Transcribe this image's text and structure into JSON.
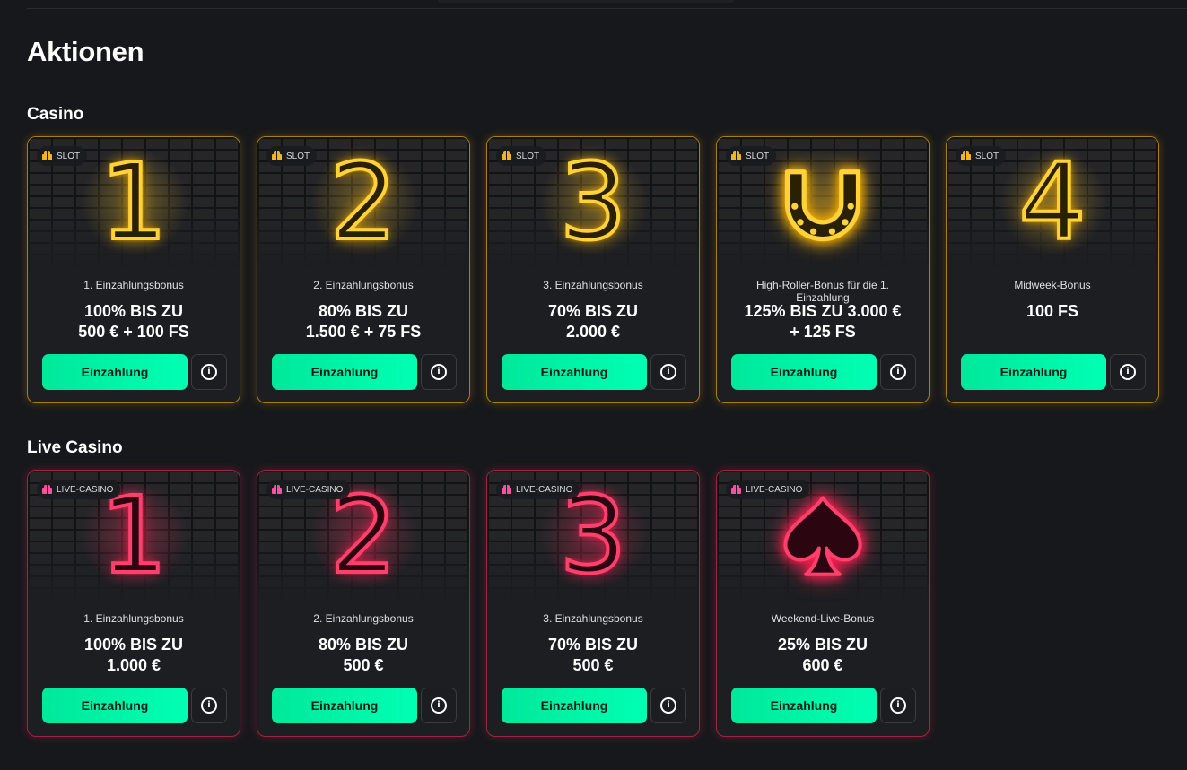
{
  "page_title": "Aktionen",
  "sections": [
    {
      "title": "Casino",
      "cards": [
        {
          "badge": "SLOT",
          "icon": "neon-number-1-icon",
          "glyph": "1",
          "name": "1. Einzahlungsbonus",
          "offer": "100% BIS ZU\n500 € + 100 FS",
          "button": "Einzahlung"
        },
        {
          "badge": "SLOT",
          "icon": "neon-number-2-icon",
          "glyph": "2",
          "name": "2. Einzahlungsbonus",
          "offer": "80% BIS ZU\n1.500 € + 75 FS",
          "button": "Einzahlung"
        },
        {
          "badge": "SLOT",
          "icon": "neon-number-3-icon",
          "glyph": "3",
          "name": "3. Einzahlungsbonus",
          "offer": "70% BIS ZU\n2.000 €",
          "button": "Einzahlung"
        },
        {
          "badge": "SLOT",
          "icon": "neon-horseshoe-icon",
          "glyph": "",
          "name": "High-Roller-Bonus für die 1. Einzahlung",
          "offer": "125% BIS ZU 3.000 €\n+ 125 FS",
          "button": "Einzahlung"
        },
        {
          "badge": "SLOT",
          "icon": "neon-number-4-icon",
          "glyph": "4",
          "name": "Midweek-Bonus",
          "offer": "100 FS",
          "button": "Einzahlung"
        }
      ]
    },
    {
      "title": "Live Casino",
      "cards": [
        {
          "badge": "LIVE-CASINO",
          "icon": "neon-number-1-icon",
          "glyph": "1",
          "name": "1. Einzahlungsbonus",
          "offer": "100% BIS ZU\n1.000 €",
          "button": "Einzahlung"
        },
        {
          "badge": "LIVE-CASINO",
          "icon": "neon-number-2-icon",
          "glyph": "2",
          "name": "2. Einzahlungsbonus",
          "offer": "80% BIS ZU\n500 €",
          "button": "Einzahlung"
        },
        {
          "badge": "LIVE-CASINO",
          "icon": "neon-number-3-icon",
          "glyph": "3",
          "name": "3. Einzahlungsbonus",
          "offer": "70% BIS ZU\n500 €",
          "button": "Einzahlung"
        },
        {
          "badge": "LIVE-CASINO",
          "icon": "neon-spade-icon",
          "glyph": "",
          "name": "Weekend-Live-Bonus",
          "offer": "25% BIS ZU\n600 €",
          "button": "Einzahlung"
        }
      ]
    }
  ],
  "colors": {
    "background": "#17181b",
    "deposit_button": "#00f5a8",
    "slot_neon": "#ffd23a",
    "live_neon": "#ff3f6c",
    "slot_badge_icon": "#f2b51d",
    "live_badge_icon": "#ff4fa0"
  }
}
